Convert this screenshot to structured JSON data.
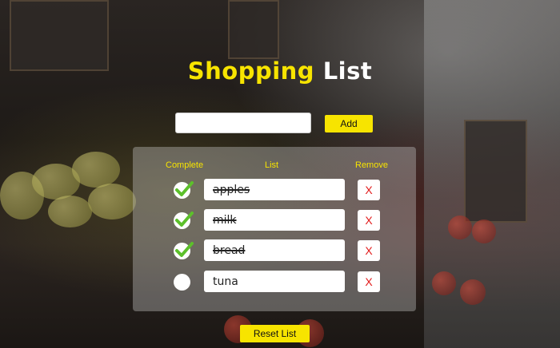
{
  "header": {
    "title_part1": "Shopping",
    "title_part2": "List"
  },
  "add_form": {
    "input_value": "",
    "input_placeholder": "",
    "add_label": "Add"
  },
  "columns": {
    "complete": "Complete",
    "list": "List",
    "remove": "Remove"
  },
  "items": [
    {
      "text": "apples",
      "complete": true,
      "remove_label": "X"
    },
    {
      "text": "milk",
      "complete": true,
      "remove_label": "X"
    },
    {
      "text": "bread",
      "complete": true,
      "remove_label": "X"
    },
    {
      "text": "tuna",
      "complete": false,
      "remove_label": "X"
    }
  ],
  "footer": {
    "reset_label": "Reset List"
  },
  "colors": {
    "accent": "#f7e400",
    "check": "#5cc02a",
    "remove": "#e21b1b"
  },
  "icons": {
    "checkmark": "checkmark-icon",
    "remove": "x-icon"
  }
}
